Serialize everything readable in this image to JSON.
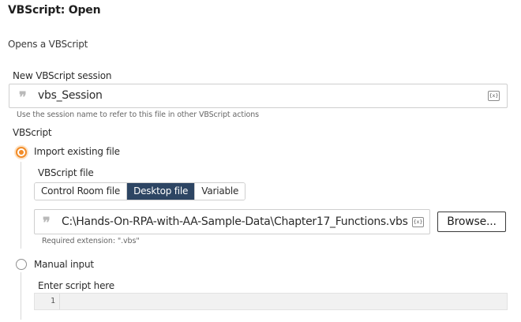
{
  "header": {
    "title": "VBScript: Open",
    "subtitle": "Opens a VBScript"
  },
  "session": {
    "label": "New VBScript session",
    "value": "vbs_Session",
    "var_icon": "{x}",
    "hint": "Use the session name to refer to this file in other VBScript actions"
  },
  "vbscript": {
    "section_label": "VBScript",
    "option_import_label": "Import existing file",
    "option_import_selected": true,
    "file": {
      "label": "VBScript file",
      "tabs": [
        {
          "label": "Control Room file",
          "active": false
        },
        {
          "label": "Desktop file",
          "active": true
        },
        {
          "label": "Variable",
          "active": false
        }
      ],
      "path_value": "C:\\Hands-On-RPA-with-AA-Sample-Data\\Chapter17_Functions.vbs",
      "var_icon": "{x}",
      "browse_label": "Browse...",
      "hint": "Required extension: \".vbs\""
    },
    "option_manual_label": "Manual input",
    "option_manual_selected": false,
    "script": {
      "label": "Enter script here",
      "line_number": "1"
    }
  },
  "colors": {
    "accent": "#f28c28",
    "active_tab": "#2d4563"
  },
  "icons": {
    "quote": "text-quote-icon",
    "variable": "variable-insert-icon"
  }
}
